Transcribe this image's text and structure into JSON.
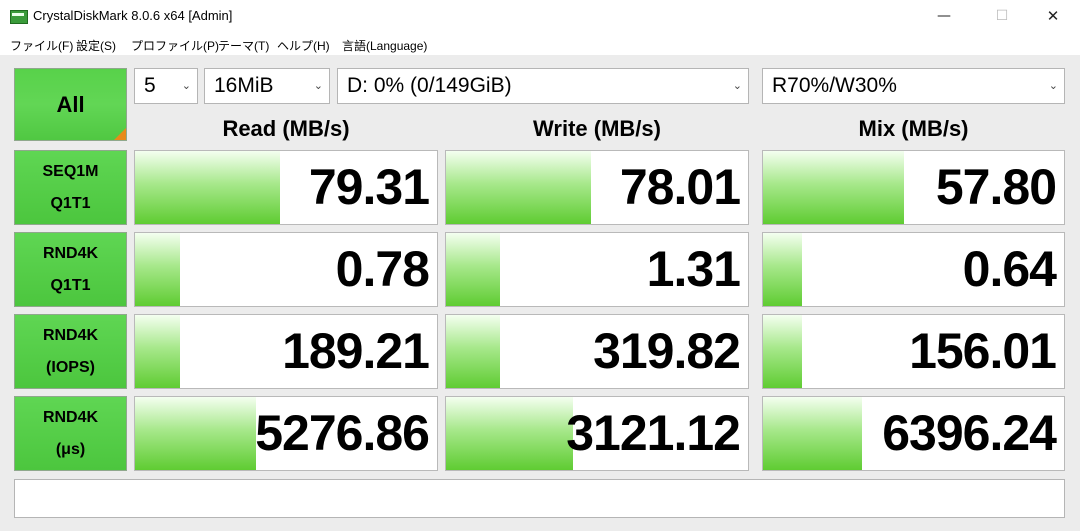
{
  "window": {
    "title": "CrystalDiskMark 8.0.6 x64 [Admin]",
    "minimize": "—",
    "maximize": "☐",
    "close": "✕"
  },
  "menu": [
    "ファイル(F)",
    "設定(S)",
    "プロファイル(P)",
    "テーマ(T)",
    "ヘルプ(H)",
    "言語(Language)"
  ],
  "controls": {
    "all_button": "All",
    "count": "5",
    "size": "16MiB",
    "drive": "D: 0% (0/149GiB)",
    "mix": "R70%/W30%"
  },
  "headers": {
    "read": "Read (MB/s)",
    "write": "Write (MB/s)",
    "mix": "Mix (MB/s)"
  },
  "rows": [
    {
      "line1": "SEQ1M",
      "line2": "Q1T1",
      "read": "79.31",
      "write": "78.01",
      "mix": "57.80",
      "read_fill": 0.48,
      "write_fill": 0.48,
      "mix_fill": 0.47
    },
    {
      "line1": "RND4K",
      "line2": "Q1T1",
      "read": "0.78",
      "write": "1.31",
      "mix": "0.64",
      "read_fill": 0.15,
      "write_fill": 0.18,
      "mix_fill": 0.13
    },
    {
      "line1": "RND4K",
      "line2": "(IOPS)",
      "read": "189.21",
      "write": "319.82",
      "mix": "156.01",
      "read_fill": 0.15,
      "write_fill": 0.18,
      "mix_fill": 0.13
    },
    {
      "line1": "RND4K",
      "line2": "(μs)",
      "read": "5276.86",
      "write": "3121.12",
      "mix": "6396.24",
      "read_fill": 0.4,
      "write_fill": 0.42,
      "mix_fill": 0.33
    }
  ],
  "comment": "",
  "colors": {
    "accent_green": "#5fcc32",
    "corner_orange": "#e88a1a"
  }
}
